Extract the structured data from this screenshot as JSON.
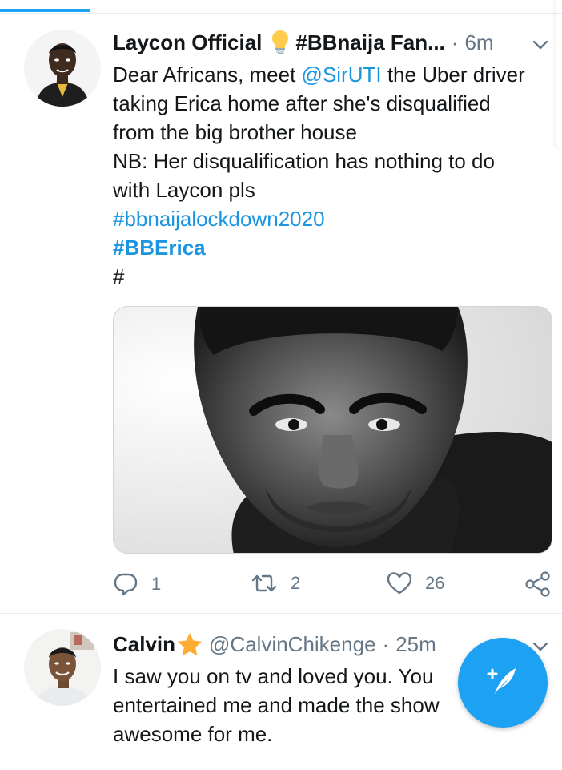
{
  "tweets": [
    {
      "name": "Laycon Official",
      "handle": "#BBnaija Fan...",
      "time": "6m",
      "text_lines": [
        [
          "Dear Africans, meet ",
          "@SirUTI",
          " the Uber driver"
        ],
        "taking Erica home after she's disqualified",
        "from the big brother house",
        "NB: Her disqualification has nothing to do",
        "with Laycon pls",
        "#bbnaijalockdown2020",
        "#BBErica",
        "#"
      ],
      "actions": {
        "replies": "1",
        "retweets": "2",
        "likes": "26"
      }
    },
    {
      "name": "Calvin",
      "handle": "@CalvinChikenge",
      "time": "25m",
      "text_lines": [
        "I saw you on tv and loved you. You",
        "entertained me and made the show",
        "awesome for me."
      ]
    }
  ],
  "separator": "·",
  "icons": {
    "reply": "reply-icon",
    "retweet": "retweet-icon",
    "like": "heart-icon",
    "share": "share-icon",
    "caret": "chevron-down-icon",
    "bulb": "lightbulb-icon",
    "star": "star-icon",
    "compose": "compose-tweet-icon"
  },
  "colors": {
    "accent": "#1da1f2",
    "link": "#1b95e0",
    "secondary_text": "#657786",
    "primary_text": "#14171a",
    "divider": "#e6ecf0"
  }
}
